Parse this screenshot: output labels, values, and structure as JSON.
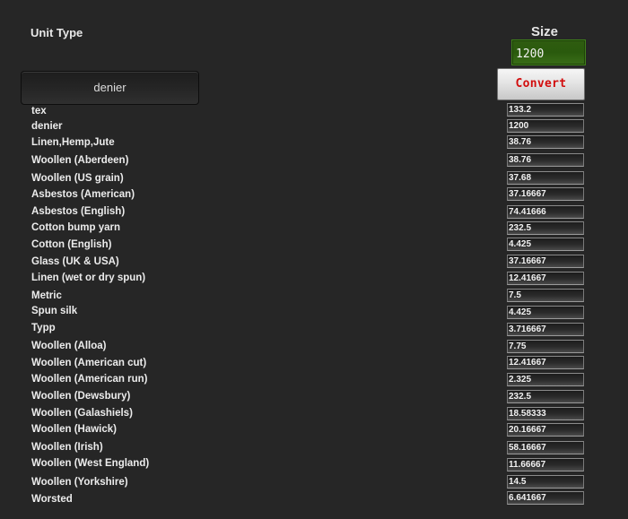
{
  "header": {
    "unit_type_label": "Unit Type",
    "size_label": "Size"
  },
  "size_input": {
    "value": "1200"
  },
  "convert_button": {
    "label": "Convert"
  },
  "unit_dropdown": {
    "selected": "denier"
  },
  "results": [
    {
      "label": "tex",
      "value": "133.2"
    },
    {
      "label": "denier",
      "value": "1200"
    },
    {
      "label": "Linen,Hemp,Jute",
      "value": "38.76"
    },
    {
      "label": "Woollen (Aberdeen)",
      "value": "38.76"
    },
    {
      "label": "Woollen (US grain)",
      "value": "37.68"
    },
    {
      "label": "Asbestos (American)",
      "value": "37.16667"
    },
    {
      "label": "Asbestos (English)",
      "value": "74.41666"
    },
    {
      "label": "Cotton bump yarn",
      "value": "232.5"
    },
    {
      "label": "Cotton (English)",
      "value": "4.425"
    },
    {
      "label": "Glass (UK & USA)",
      "value": "37.16667"
    },
    {
      "label": "Linen (wet or dry spun)",
      "value": "12.41667"
    },
    {
      "label": "Metric",
      "value": "7.5"
    },
    {
      "label": "Spun silk",
      "value": "4.425"
    },
    {
      "label": "Typp",
      "value": "3.716667"
    },
    {
      "label": "Woollen (Alloa)",
      "value": "7.75"
    },
    {
      "label": "Woollen (American cut)",
      "value": "12.41667"
    },
    {
      "label": "Woollen (American run)",
      "value": "2.325"
    },
    {
      "label": "Woollen (Dewsbury)",
      "value": "232.5"
    },
    {
      "label": "Woollen (Galashiels)",
      "value": "18.58333"
    },
    {
      "label": "Woollen (Hawick)",
      "value": "20.16667"
    },
    {
      "label": "Woollen (Irish)",
      "value": "58.16667"
    },
    {
      "label": "Woollen (West England)",
      "value": "11.66667"
    },
    {
      "label": "Woollen (Yorkshire)",
      "value": "14.5"
    },
    {
      "label": "Worsted",
      "value": "6.641667"
    }
  ]
}
